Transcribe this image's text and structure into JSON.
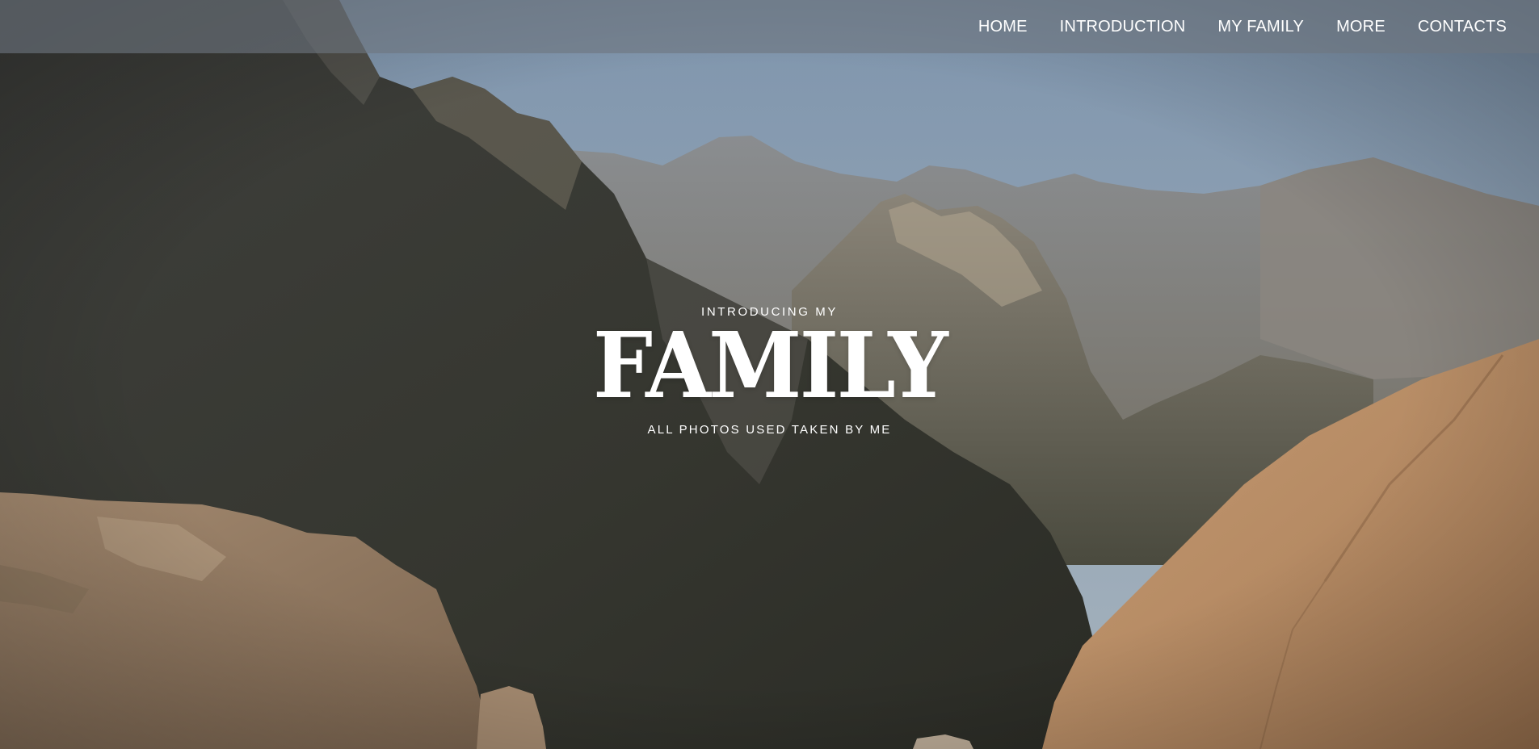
{
  "nav": {
    "items": [
      {
        "label": "HOME"
      },
      {
        "label": "INTRODUCTION"
      },
      {
        "label": "MY FAMILY"
      },
      {
        "label": "MORE"
      },
      {
        "label": "CONTACTS"
      }
    ]
  },
  "hero": {
    "kicker": "INTRODUCING MY",
    "title": "FAMILY",
    "subtitle": "ALL PHOTOS USED TAKEN BY ME"
  },
  "colors": {
    "navbar_bg": "#6e7680",
    "sky": "#8fa6bd",
    "text": "#ffffff"
  }
}
